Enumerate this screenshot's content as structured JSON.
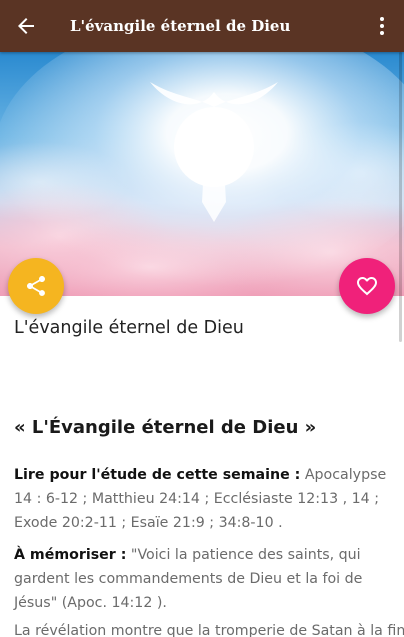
{
  "app_bar": {
    "title": "L'évangile éternel de Dieu",
    "background": "#5a3424",
    "back_icon": "arrow-left-icon",
    "menu_icon": "more-vertical-icon"
  },
  "hero": {
    "image": "angel-in-light-clouds"
  },
  "fabs": {
    "share": {
      "icon": "share-icon",
      "color": "#f5b520"
    },
    "favorite": {
      "icon": "heart-outline-icon",
      "color": "#f0217a"
    }
  },
  "article": {
    "title": "L'évangile éternel de Dieu",
    "lesson_heading": "« L'Évangile éternel de Dieu »",
    "reading_label": "Lire pour l'étude de cette semaine :",
    "reading_text": "Apocalypse 14 : 6-12 ; Matthieu 24:14 ; Ecclésiaste 12:13 , 14 ; Exode 20:2-11 ; Esaïe 21:9 ; 34:8-10 .",
    "memorize_label": "À mémoriser :",
    "memorize_text": "\"Voici la patience des saints, qui gardent les commandements de Dieu et la foi de Jésus\" (Apoc. 14:12 ).",
    "intro_text": "La révélation montre que la tromperie de Satan à la fin"
  }
}
